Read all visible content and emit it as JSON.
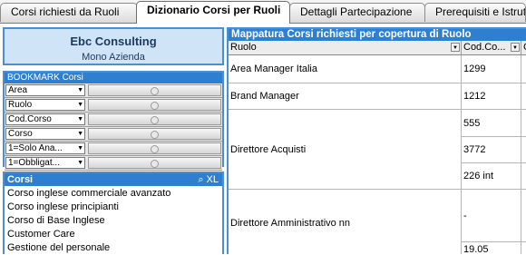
{
  "tabs": [
    {
      "label": "Corsi richiesti da Ruoli",
      "active": false
    },
    {
      "label": "Dizionario Corsi per Ruoli",
      "active": true
    },
    {
      "label": "Dettagli Partecipazione",
      "active": false
    },
    {
      "label": "Prerequisiti e Istruttori",
      "active": false
    }
  ],
  "company": {
    "name": "Ebc Consulting",
    "subtitle": "Mono Azienda"
  },
  "bookmark": {
    "title": "BOOKMARK Corsi",
    "fields": [
      "Area",
      "Ruolo",
      "Cod.Corso",
      "Corso",
      "1=Solo Ana...",
      "1=Obbligat..."
    ]
  },
  "corsi": {
    "title": "Corsi",
    "tools": "⌕ XL",
    "items": [
      "Corso  inglese commerciale avanzato",
      "Corso  inglese principianti",
      "Corso di Base Inglese",
      "Customer Care",
      "Gestione del personale"
    ]
  },
  "table": {
    "title": "Mappatura Corsi richiesti per copertura di Ruolo",
    "columns": [
      "Ruolo",
      "Cod.Co...",
      "C"
    ],
    "rows": [
      {
        "ruolo": "Area Manager Italia",
        "codes": [
          "1299"
        ]
      },
      {
        "ruolo": "Brand Manager",
        "codes": [
          "1212"
        ]
      },
      {
        "ruolo": "Direttore Acquisti",
        "codes": [
          "555",
          "3772",
          "226 int"
        ]
      },
      {
        "ruolo": "Direttore Amministrativo nn",
        "codes": [
          "-",
          "19.05"
        ]
      }
    ]
  },
  "colors": {
    "accent": "#2f7fd0",
    "panel_bg": "#cfe4f6"
  }
}
